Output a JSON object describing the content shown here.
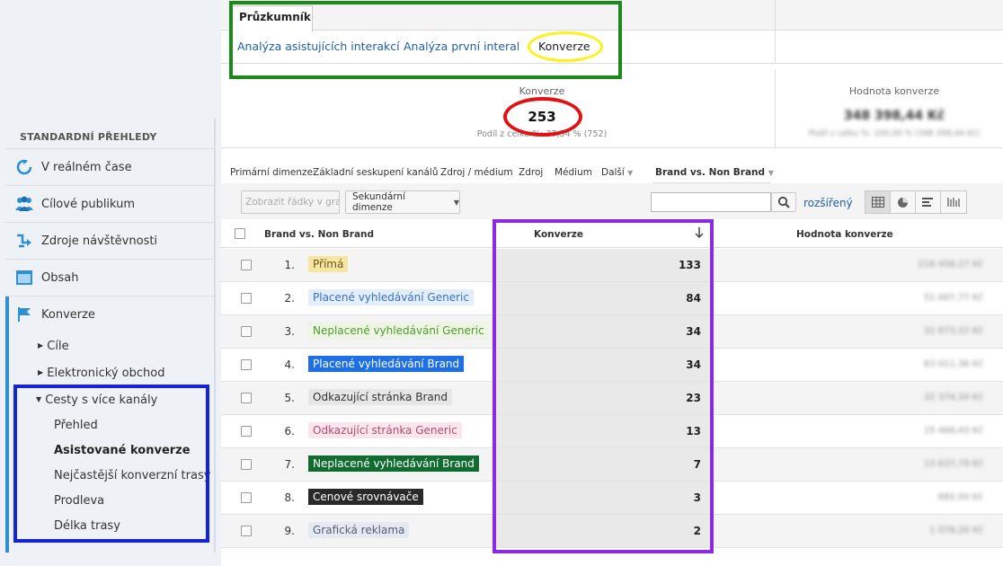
{
  "sidebar": {
    "heading": "STANDARDNÍ PŘEHLEDY",
    "items": [
      {
        "label": "V reálném čase",
        "icon": "refresh-icon"
      },
      {
        "label": "Cílové publikum",
        "icon": "people-icon"
      },
      {
        "label": "Zdroje návštěvnosti",
        "icon": "arrows-icon"
      },
      {
        "label": "Obsah",
        "icon": "window-icon"
      },
      {
        "label": "Konverze",
        "icon": "flag-icon"
      }
    ],
    "conversions_sub": [
      {
        "label": "Cíle"
      },
      {
        "label": "Elektronický obchod"
      },
      {
        "label": "Cesty s více kanály"
      }
    ],
    "mcf_sub": [
      {
        "label": "Přehled"
      },
      {
        "label": "Asistované konverze"
      },
      {
        "label": "Nejčastější konverzní trasy"
      },
      {
        "label": "Prodleva"
      },
      {
        "label": "Délka trasy"
      }
    ]
  },
  "explorer": {
    "tab_label": "Průzkumník",
    "subtabs": [
      {
        "label": "Analýza asistujících interakcí"
      },
      {
        "label": "Analýza první interakce"
      },
      {
        "label": "Konverze"
      }
    ]
  },
  "summary": {
    "conv_title": "Konverze",
    "conv_value": "253",
    "conv_sub": "Podíl z celku %: 37,54 % (752)",
    "value_title": "Hodnota konverze",
    "value_value": "348 398,44 Kč",
    "value_sub": "Podíl z celku %: 100,00 % (348 398,44 Kč)"
  },
  "dimensions": {
    "label": "Primární dimenze:",
    "options": [
      {
        "label": "Základní seskupení kanálů"
      },
      {
        "label": "Zdroj / médium"
      },
      {
        "label": "Zdroj"
      },
      {
        "label": "Médium"
      },
      {
        "label": "Další"
      }
    ],
    "selected": "Brand vs. Non Brand"
  },
  "toolbar": {
    "plot_rows": "Zobrazit řádky v grafu",
    "secondary_dim": "Sekundární dimenze",
    "advanced": "rozšířený"
  },
  "table": {
    "col_dim": "Brand vs. Non Brand",
    "col_conv": "Konverze",
    "col_value": "Hodnota konverze",
    "rows": [
      {
        "n": "1.",
        "label": "Přímá",
        "conv": "133",
        "value": "216 458,27 Kč",
        "bg": "#f7e6a2",
        "fg": "#6b5a1a"
      },
      {
        "n": "2.",
        "label": "Placené vyhledávání Generic",
        "conv": "84",
        "value": "51 007,77 Kč",
        "bg": "#e3eefc",
        "fg": "#3a6fc2"
      },
      {
        "n": "3.",
        "label": "Neplacené vyhledávání Generic",
        "conv": "34",
        "value": "31 673,22 Kč",
        "bg": "#eef7e3",
        "fg": "#4f9a2f"
      },
      {
        "n": "4.",
        "label": "Placené vyhledávání Brand",
        "conv": "34",
        "value": "63 011,36 Kč",
        "bg": "#1f6fe5",
        "fg": "#ffffff"
      },
      {
        "n": "5.",
        "label": "Odkazující stránka Brand",
        "conv": "23",
        "value": "32 374,34 Kč",
        "bg": "#e6e6e6",
        "fg": "#333333"
      },
      {
        "n": "6.",
        "label": "Odkazující stránka Generic",
        "conv": "13",
        "value": "15 466,43 Kč",
        "bg": "#fce6ee",
        "fg": "#b04a72"
      },
      {
        "n": "7.",
        "label": "Neplacené vyhledávání Brand",
        "conv": "7",
        "value": "13 637,79 Kč",
        "bg": "#0f6b2e",
        "fg": "#ffffff"
      },
      {
        "n": "8.",
        "label": "Cenové srovnávače",
        "conv": "3",
        "value": "682,50 Kč",
        "bg": "#2a2a2a",
        "fg": "#ffffff"
      },
      {
        "n": "9.",
        "label": "Grafická reklama",
        "conv": "2",
        "value": "1 076,20 Kč",
        "bg": "#e4e9f2",
        "fg": "#555f75"
      }
    ]
  },
  "colors": {
    "green_highlight": "#1b8a1b",
    "blue_highlight": "#1523d6",
    "purple_highlight": "#8a2be2",
    "yellow_highlight": "#ffef1a",
    "red_highlight": "#e01212",
    "link": "#1e5fa8"
  }
}
